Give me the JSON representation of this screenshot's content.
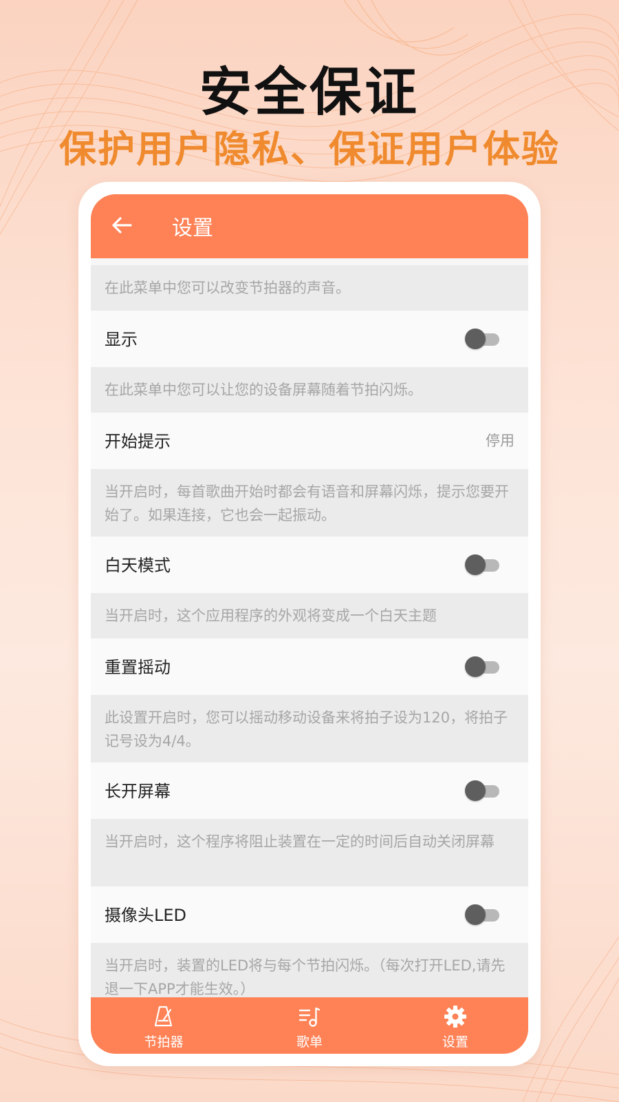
{
  "headline": "安全保证",
  "subline": "保护用户隐私、保证用户体验",
  "colors": {
    "accent": "#fe8256",
    "subline": "#f08a2e",
    "desc_bg": "#ebebeb"
  },
  "appbar": {
    "back_icon": "arrow-left-icon",
    "title": "设置"
  },
  "settings": {
    "intro_desc": "在此菜单中您可以改变节拍器的声音。",
    "display": {
      "label": "显示",
      "enabled": false
    },
    "display_desc": "在此菜单中您可以让您的设备屏幕随着节拍闪烁。",
    "start_prompt": {
      "label": "开始提示",
      "value": "停用"
    },
    "start_prompt_desc": "当开启时，每首歌曲开始时都会有语音和屏幕闪烁，提示您要开始了。如果连接，它也会一起振动。",
    "day_mode": {
      "label": "白天模式",
      "enabled": false
    },
    "day_mode_desc": "当开启时，这个应用程序的外观将变成一个白天主题",
    "shake_reset": {
      "label": "重置摇动",
      "enabled": false
    },
    "shake_reset_desc": "此设置开启时，您可以摇动移动设备来将拍子设为120，将拍子记号设为4/4。",
    "keep_screen_on": {
      "label": "长开屏幕",
      "enabled": false
    },
    "keep_screen_on_desc": "当开启时，这个程序将阻止装置在一定的时间后自动关闭屏幕",
    "camera_led": {
      "label": "摄像头LED",
      "enabled": false
    },
    "camera_led_desc": "当开启时，装置的LED将与每个节拍闪烁。（每次打开LED,请先退一下APP才能生效。）"
  },
  "tabs": [
    {
      "label": "节拍器",
      "icon": "metronome-icon"
    },
    {
      "label": "歌单",
      "icon": "playlist-icon"
    },
    {
      "label": "设置",
      "icon": "gear-icon",
      "active": true
    }
  ]
}
